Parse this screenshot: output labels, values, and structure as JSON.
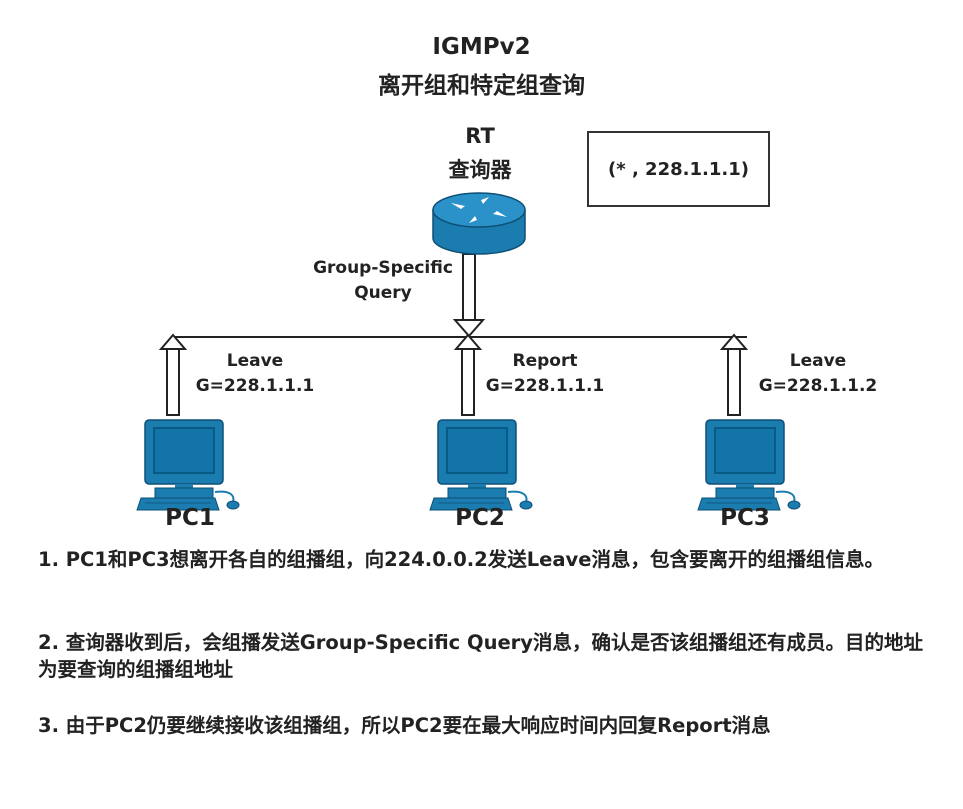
{
  "header": {
    "title": "IGMPv2",
    "subtitle": "离开组和特定组查询"
  },
  "router": {
    "name": "RT",
    "role": "查询器",
    "icon": "router-icon",
    "color": "#1b7cb0"
  },
  "group_box": {
    "text": "(* , 228.1.1.1)"
  },
  "query": {
    "line1": "Group-Specific",
    "line2": "Query"
  },
  "pcs": [
    {
      "name": "PC1",
      "msg": "Leave",
      "group": "G=228.1.1.1",
      "icon": "computer-icon"
    },
    {
      "name": "PC2",
      "msg": "Report",
      "group": "G=228.1.1.1",
      "icon": "computer-icon"
    },
    {
      "name": "PC3",
      "msg": "Leave",
      "group": "G=228.1.1.2",
      "icon": "computer-icon"
    }
  ],
  "notes": [
    "1. PC1和PC3想离开各自的组播组，向224.0.0.2发送Leave消息，包含要离开的组播组信息。",
    "2. 查询器收到后，会组播发送Group-Specific Query消息，确认是否该组播组还有成员。目的地址为要查询的组播组地址",
    "3. 由于PC2仍要继续接收该组播组，所以PC2要在最大响应时间内回复Report消息"
  ]
}
